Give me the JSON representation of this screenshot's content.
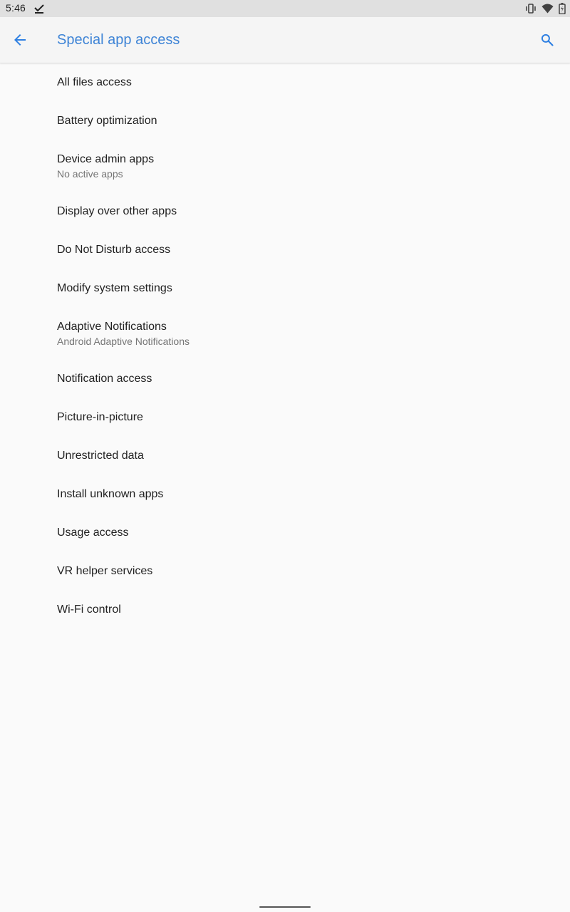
{
  "status_bar": {
    "time": "5:46"
  },
  "app_bar": {
    "title": "Special app access",
    "accent_color": "#3e84d6"
  },
  "icons": {
    "back": "arrow-back-icon",
    "search": "search-icon",
    "notification": "check-icon",
    "vibrate": "vibrate-icon",
    "wifi": "wifi-icon",
    "battery": "battery-charging-icon"
  },
  "items": [
    {
      "title": "All files access",
      "summary": ""
    },
    {
      "title": "Battery optimization",
      "summary": ""
    },
    {
      "title": "Device admin apps",
      "summary": "No active apps"
    },
    {
      "title": "Display over other apps",
      "summary": ""
    },
    {
      "title": "Do Not Disturb access",
      "summary": ""
    },
    {
      "title": "Modify system settings",
      "summary": ""
    },
    {
      "title": "Adaptive Notifications",
      "summary": "Android Adaptive Notifications"
    },
    {
      "title": "Notification access",
      "summary": ""
    },
    {
      "title": "Picture-in-picture",
      "summary": ""
    },
    {
      "title": "Unrestricted data",
      "summary": ""
    },
    {
      "title": "Install unknown apps",
      "summary": ""
    },
    {
      "title": "Usage access",
      "summary": ""
    },
    {
      "title": "VR helper services",
      "summary": ""
    },
    {
      "title": "Wi-Fi control",
      "summary": ""
    }
  ]
}
